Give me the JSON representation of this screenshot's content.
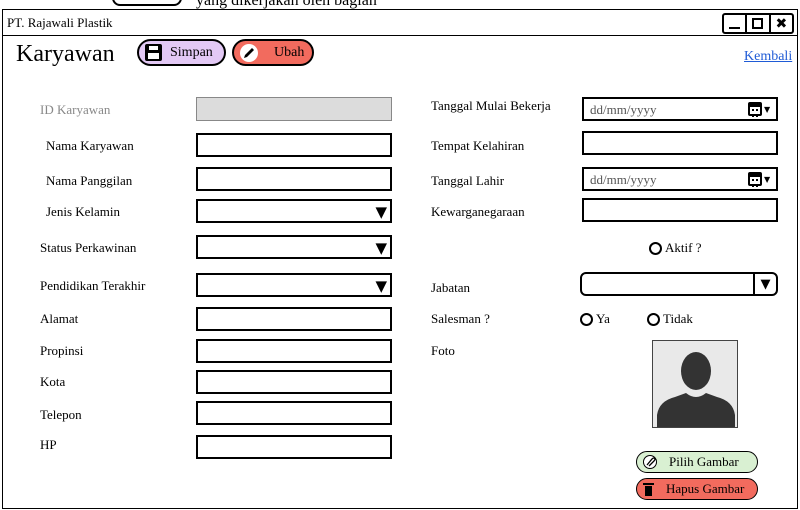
{
  "top_cut_text": "yang dikerjakan oleh bagian",
  "window": {
    "title": "PT. Rajawali Plastik",
    "controls": [
      "minimize-icon",
      "maximize-icon",
      "close-icon"
    ]
  },
  "header": {
    "title": "Karyawan",
    "save_label": "Simpan",
    "edit_label": "Ubah",
    "back_link": "Kembali"
  },
  "left_form": {
    "id_label": "ID Karyawan",
    "name_label": "Nama Karyawan",
    "nickname_label": "Nama Panggilan",
    "gender_label": "Jenis Kelamin",
    "marital_label": "Status Perkawinan",
    "education_label": "Pendidikan Terakhir",
    "address_label": "Alamat",
    "province_label": "Propinsi",
    "city_label": "Kota",
    "phone_label": "Telepon",
    "mobile_label": "HP"
  },
  "right_form": {
    "start_date_label": "Tanggal Mulai Bekerja",
    "start_date_placeholder": "dd/mm/yyyy",
    "birthplace_label": "Tempat Kelahiran",
    "birthdate_label": "Tanggal Lahir",
    "birthdate_placeholder": "dd/mm/yyyy",
    "nationality_label": "Kewarganegaraan",
    "active_label": "Aktif ?",
    "position_label": "Jabatan",
    "salesman_label": "Salesman ?",
    "salesman_yes": "Ya",
    "salesman_no": "Tidak",
    "photo_label": "Foto",
    "choose_photo_label": "Pilih Gambar",
    "delete_photo_label": "Hapus Gambar"
  },
  "colors": {
    "save_button_bg": "#e3c9f5",
    "edit_button_bg": "#f26b5e",
    "choose_button_bg": "#d9f0d2",
    "delete_button_bg": "#f26b5e",
    "link": "#1f5bd6",
    "disabled_field": "#dcdcdc"
  }
}
